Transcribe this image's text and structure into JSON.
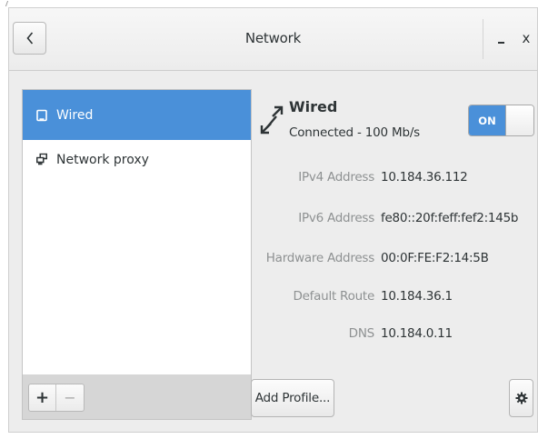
{
  "window": {
    "title": "Network",
    "back_icon": "chevron-left-icon",
    "minimize_label": "",
    "close_label": "x"
  },
  "sidebar": {
    "items": [
      {
        "label": "Wired",
        "icon": "wired-device-icon",
        "selected": true
      },
      {
        "label": "Network proxy",
        "icon": "network-proxy-icon",
        "selected": false
      }
    ],
    "add_label": "+",
    "remove_label": "−"
  },
  "device": {
    "name": "Wired",
    "status": "Connected - 100 Mb/s",
    "icon": "wired-connection-icon",
    "toggle_label": "ON",
    "toggle_on": true
  },
  "details": [
    {
      "label": "IPv4 Address",
      "value": "10.184.36.112"
    },
    {
      "label": "IPv6 Address",
      "value": "fe80::20f:feff:fef2:145b"
    },
    {
      "label": "Hardware Address",
      "value": "00:0F:FE:F2:14:5B"
    },
    {
      "label": "Default Route",
      "value": "10.184.36.1"
    },
    {
      "label": "DNS",
      "value": "10.184.0.11"
    }
  ],
  "actions": {
    "add_profile_label": "Add Profile...",
    "settings_icon": "gear-icon"
  },
  "colors": {
    "accent": "#4a90d9",
    "window_bg": "#ededed",
    "label_gray": "#8e9192",
    "text": "#2e3436"
  }
}
